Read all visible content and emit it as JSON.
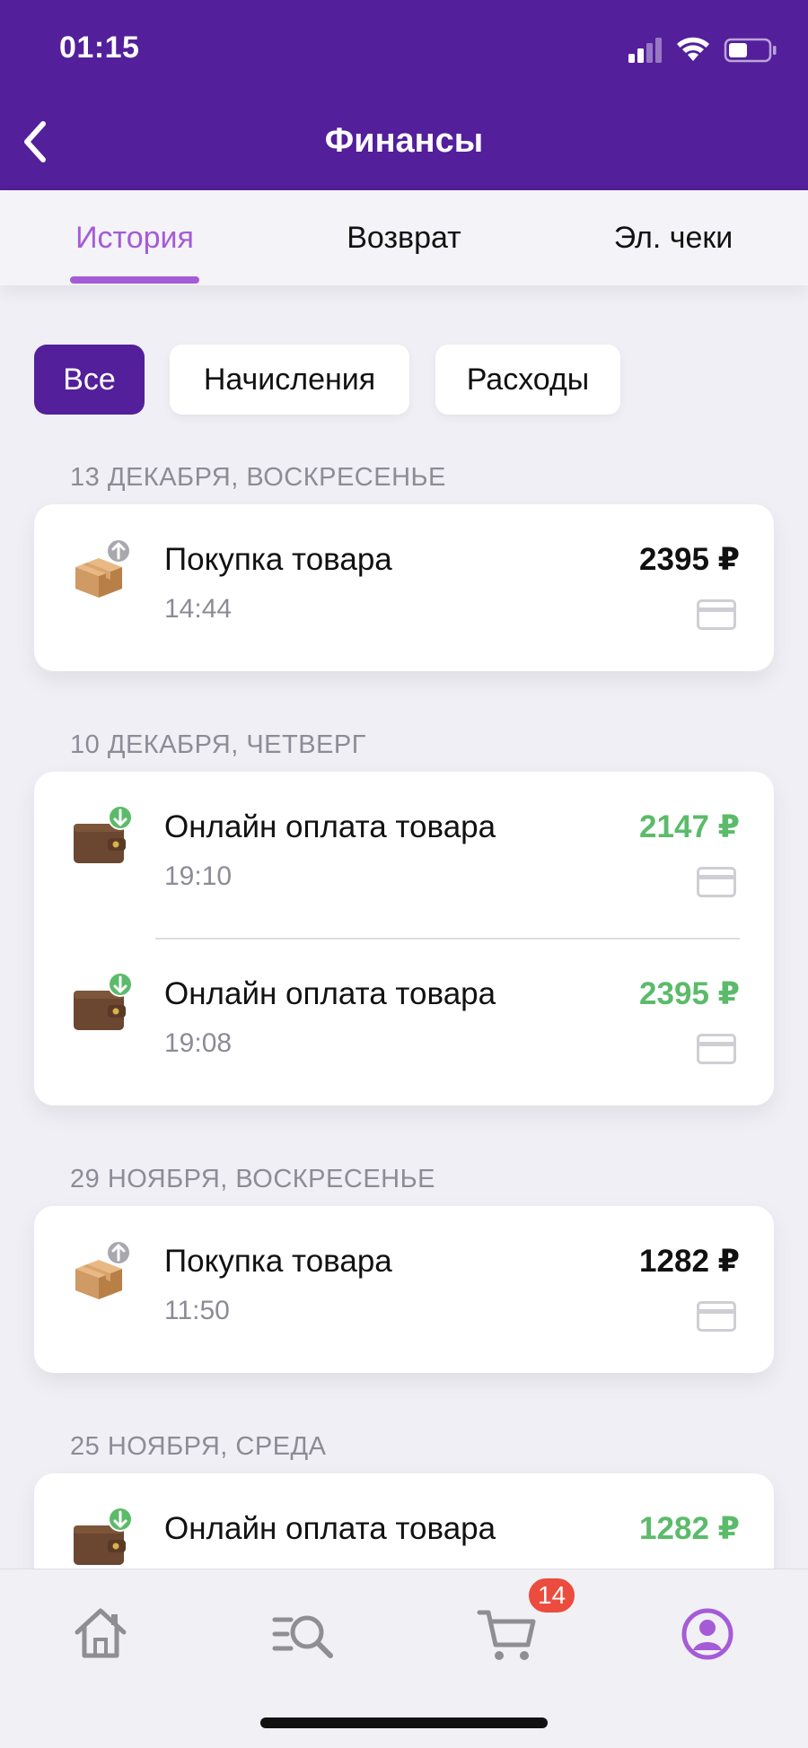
{
  "status": {
    "time": "01:15"
  },
  "header": {
    "title": "Финансы"
  },
  "tabs": [
    {
      "label": "История"
    },
    {
      "label": "Возврат"
    },
    {
      "label": "Эл. чеки"
    }
  ],
  "filters": [
    {
      "label": "Все"
    },
    {
      "label": "Начисления"
    },
    {
      "label": "Расходы"
    }
  ],
  "groups": [
    {
      "date": "13 ДЕКАБРЯ, ВОСКРЕСЕНЬЕ",
      "items": [
        {
          "title": "Покупка товара",
          "time": "14:44",
          "amount": "2395 ₽",
          "icon": "box-upload-icon"
        }
      ]
    },
    {
      "date": "10 ДЕКАБРЯ, ЧЕТВЕРГ",
      "items": [
        {
          "title": "Онлайн оплата товара",
          "time": "19:10",
          "amount": "2147 ₽",
          "icon": "wallet-download-icon"
        },
        {
          "title": "Онлайн оплата товара",
          "time": "19:08",
          "amount": "2395 ₽",
          "icon": "wallet-download-icon"
        }
      ]
    },
    {
      "date": "29 НОЯБРЯ, ВОСКРЕСЕНЬЕ",
      "items": [
        {
          "title": "Покупка товара",
          "time": "11:50",
          "amount": "1282 ₽",
          "icon": "box-upload-icon"
        }
      ]
    },
    {
      "date": "25 НОЯБРЯ, СРЕДА",
      "items": [
        {
          "title": "Онлайн оплата товара",
          "amount": "1282 ₽",
          "icon": "wallet-download-icon"
        }
      ]
    }
  ],
  "bottom_nav": {
    "cart_badge": "14",
    "items": [
      "home-icon",
      "catalog-search-icon",
      "cart-icon",
      "profile-icon"
    ]
  },
  "colors": {
    "brand": "#531f9b",
    "accent": "#a55bd7",
    "income": "#5cbb6a",
    "badge": "#ec4c3d"
  }
}
